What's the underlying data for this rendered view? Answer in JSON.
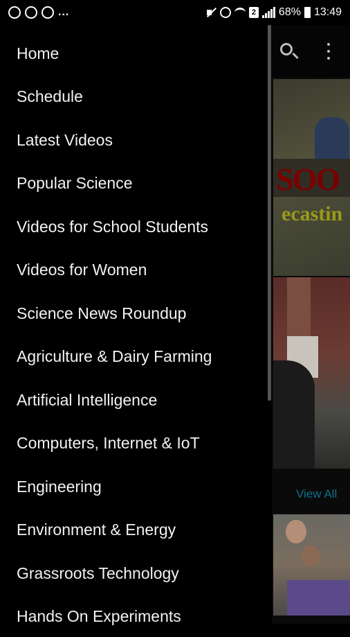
{
  "status_bar": {
    "overflow": "...",
    "sim_slot": "2",
    "battery_percent": "68%",
    "time": "13:49"
  },
  "background": {
    "thumb1_text_top": "SOO",
    "thumb1_text_bottom": "ecastin",
    "view_all_label": "View All"
  },
  "drawer": {
    "items": [
      {
        "label": "Home"
      },
      {
        "label": "Schedule"
      },
      {
        "label": "Latest Videos"
      },
      {
        "label": "Popular Science"
      },
      {
        "label": "Videos for School Students"
      },
      {
        "label": "Videos for Women"
      },
      {
        "label": "Science News Roundup"
      },
      {
        "label": "Agriculture & Dairy Farming"
      },
      {
        "label": "Artificial Intelligence"
      },
      {
        "label": "Computers, Internet & IoT"
      },
      {
        "label": "Engineering"
      },
      {
        "label": "Environment & Energy"
      },
      {
        "label": "Grassroots Technology"
      },
      {
        "label": "Hands On Experiments"
      }
    ]
  }
}
